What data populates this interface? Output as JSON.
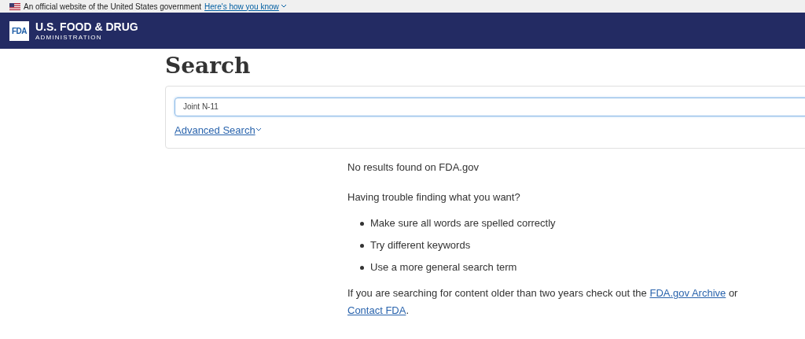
{
  "gov_banner": {
    "text": "An official website of the United States government",
    "link": "Here's how you know"
  },
  "header": {
    "logo_mark": "FDA",
    "title": "U.S. FOOD & DRUG",
    "subtitle": "ADMINISTRATION"
  },
  "page_title": "Search",
  "search": {
    "value": "Joint N-11",
    "advanced_link": "Advanced Search"
  },
  "results": {
    "message": "No results found on FDA.gov",
    "help_heading": "Having trouble finding what you want?",
    "tips": [
      "Make sure all words are spelled correctly",
      "Try different keywords",
      "Use a more general search term"
    ],
    "footer_parts": [
      {
        "kind": "text",
        "text": "If you are searching for content older than two years check out the "
      },
      {
        "kind": "link",
        "text": "FDA.gov Archive"
      },
      {
        "kind": "text",
        "text": " or "
      },
      {
        "kind": "link",
        "text": "Contact FDA"
      },
      {
        "kind": "text",
        "text": "."
      }
    ]
  }
}
